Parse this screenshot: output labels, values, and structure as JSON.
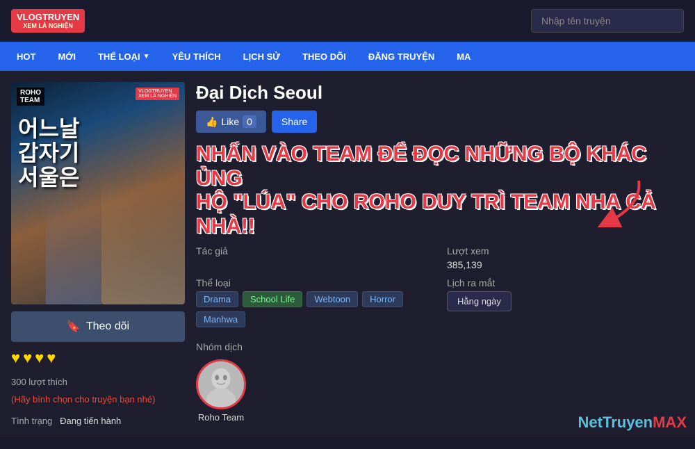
{
  "header": {
    "logo_line1": "VLOGTRUYEN",
    "logo_line2": "XEM LÀ NGHIỆN",
    "search_placeholder": "Nhập tên truyện"
  },
  "nav": {
    "items": [
      {
        "label": "HOT",
        "has_arrow": false
      },
      {
        "label": "MỚI",
        "has_arrow": false
      },
      {
        "label": "THỂ LOẠI",
        "has_arrow": true
      },
      {
        "label": "YÊU THÍCH",
        "has_arrow": false
      },
      {
        "label": "LỊCH SỬ",
        "has_arrow": false
      },
      {
        "label": "THEO DÕI",
        "has_arrow": false
      },
      {
        "label": "ĐĂNG TRUYỆN",
        "has_arrow": false
      },
      {
        "label": "MA",
        "has_arrow": false
      }
    ]
  },
  "manga": {
    "title": "Đại Dịch Seoul",
    "cover_title": "어느날 갑자기 서울은",
    "roho_badge": "ROHO\nTEAM",
    "vlog_badge": "VLOGTRUYEN\nXEM LÀ NGHIỆN",
    "like_label": "Like",
    "like_count": "0",
    "share_label": "Share",
    "overlay_line1": "NHẤN VÀO TEAM ĐỂ ĐỌC NHỮNG BỘ KHÁC ỦNG",
    "overlay_line2": "HỘ \"LÚA\" CHO ROHO DUY TRÌ TEAM NHA CẢ NHÀ!!",
    "tac_gia_label": "Tác giả",
    "tac_gia_value": "",
    "luot_xem_label": "Lượt xem",
    "luot_xem_value": "385,139",
    "the_loai_label": "Thể loại",
    "tags": [
      "Drama",
      "School Life",
      "Webtoon",
      "Horror",
      "Manhwa"
    ],
    "nhom_dich_label": "Nhóm dịch",
    "group_name": "Roho Team",
    "lich_ra_mat_label": "Lịch ra mắt",
    "lich_ra_mat_value": "Hằng ngày",
    "follow_label": "Theo dõi",
    "hearts": [
      "♥",
      "♥",
      "♥",
      "♥"
    ],
    "likes_count": "300 lượt thích",
    "likes_vote": "(Hãy bình chọn cho truyện bạn nhé)",
    "tinh_trang_label": "Tình trạng",
    "tinh_trang_value": "Đang tiến hành"
  },
  "watermark": {
    "text": "NetTruyenMAX",
    "net": "Net",
    "truyen": "Truyen",
    "max": "MAX"
  }
}
